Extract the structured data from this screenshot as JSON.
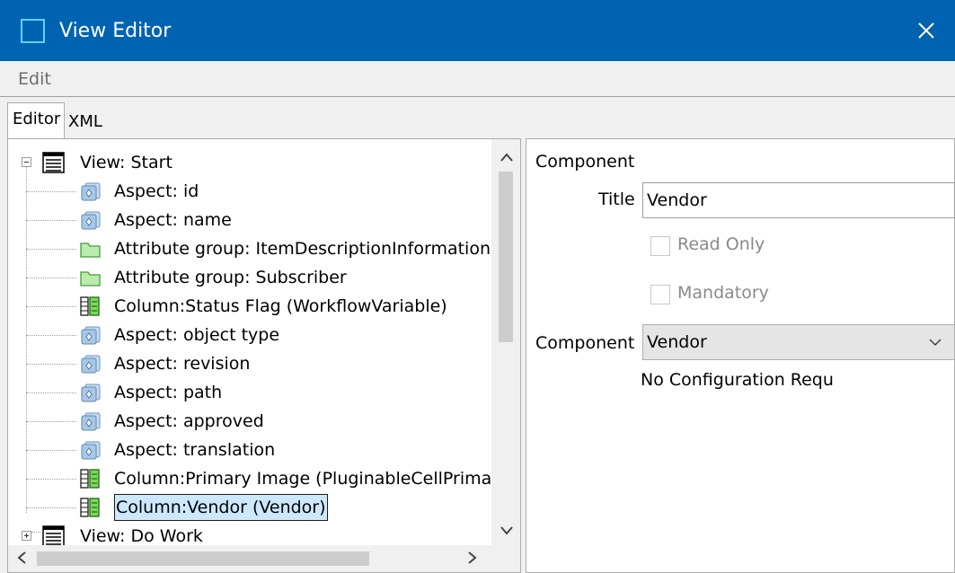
{
  "window": {
    "title": "View Editor",
    "close_glyph": "✕"
  },
  "menu": {
    "edit_label": "Edit"
  },
  "tabs": {
    "editor_label": "Editor",
    "xml_label": "XML"
  },
  "tree": {
    "root1_label": "View: Start",
    "items": [
      {
        "label": "Aspect: id",
        "icon": "aspect-icon"
      },
      {
        "label": "Aspect: name",
        "icon": "aspect-icon"
      },
      {
        "label": "Attribute group: ItemDescriptionInformation",
        "icon": "folder-icon"
      },
      {
        "label": "Attribute group: Subscriber",
        "icon": "folder-icon"
      },
      {
        "label": "Column:Status Flag (WorkflowVariable)",
        "icon": "column-icon"
      },
      {
        "label": "Aspect: object type",
        "icon": "aspect-icon"
      },
      {
        "label": "Aspect: revision",
        "icon": "aspect-icon"
      },
      {
        "label": "Aspect: path",
        "icon": "aspect-icon"
      },
      {
        "label": "Aspect: approved",
        "icon": "aspect-icon"
      },
      {
        "label": "Aspect: translation",
        "icon": "aspect-icon"
      },
      {
        "label": "Column:Primary Image (PluginableCellPrimaryImage)",
        "icon": "column-icon"
      },
      {
        "label": "Column:Vendor (Vendor)",
        "icon": "column-icon",
        "selected": true
      }
    ],
    "root2_label": "View: Do Work"
  },
  "component": {
    "header": "Component",
    "title_label": "Title",
    "title_value": "Vendor",
    "read_only_label": "Read Only",
    "mandatory_label": "Mandatory",
    "component_label": "Component",
    "component_value": "Vendor",
    "no_config_text": "No Configuration Required"
  },
  "colors": {
    "titlebar": "#0063b1",
    "selection": "#cce8ff"
  }
}
